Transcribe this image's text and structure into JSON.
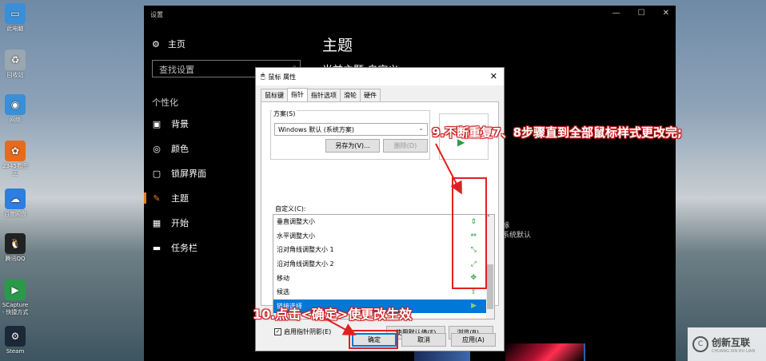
{
  "desktop_icons": [
    {
      "label": "此电脑",
      "color": "#3a8fd6",
      "glyph": "▭",
      "icon": "computer-icon"
    },
    {
      "label": "回收站",
      "color": "#9aa6b0",
      "glyph": "♻",
      "icon": "recycle-bin-icon"
    },
    {
      "label": "网络",
      "color": "#3a8fd6",
      "glyph": "◉",
      "icon": "network-icon"
    },
    {
      "label": "2345看图王",
      "color": "#e86a1a",
      "glyph": "✿",
      "icon": "app-icon"
    },
    {
      "label": "百度网盘",
      "color": "#2f7de1",
      "glyph": "☁",
      "icon": "cloud-icon"
    },
    {
      "label": "腾讯QQ",
      "color": "#222",
      "glyph": "🐧",
      "icon": "qq-icon"
    },
    {
      "label": "SCapture - 快捷方式",
      "color": "#2a9a4a",
      "glyph": "▶",
      "icon": "capture-icon"
    },
    {
      "label": "Steam",
      "color": "#1b2838",
      "glyph": "⚙",
      "icon": "steam-icon"
    }
  ],
  "settings": {
    "title": "设置",
    "home": "主页",
    "search_placeholder": "查找设置",
    "section": "个性化",
    "nav": [
      {
        "label": "背景",
        "glyph": "▣",
        "icon": "background-icon",
        "active": false
      },
      {
        "label": "颜色",
        "glyph": "◎",
        "icon": "palette-icon",
        "active": false
      },
      {
        "label": "锁屏界面",
        "glyph": "▢",
        "icon": "lock-screen-icon",
        "active": false
      },
      {
        "label": "主题",
        "glyph": "✎",
        "icon": "theme-icon",
        "active": true
      },
      {
        "label": "开始",
        "glyph": "▦",
        "icon": "start-icon",
        "active": false
      },
      {
        "label": "任务栏",
        "glyph": "▬",
        "icon": "taskbar-icon",
        "active": false
      }
    ],
    "main_title": "主题",
    "main_sub": "当前主题:自定义",
    "theme_text1": "标",
    "theme_text2": "系统默认"
  },
  "dialog": {
    "title": "鼠标 属性",
    "close": "✕",
    "tabs": [
      "鼠标键",
      "指针",
      "指针选项",
      "滑轮",
      "硬件"
    ],
    "active_tab": 1,
    "scheme_label": "方案(S)",
    "scheme_value": "Windows 默认 (系统方案)",
    "save_as": "另存为(V)...",
    "delete": "删除(D)",
    "custom_label": "自定义(C):",
    "cursor_rows": [
      {
        "label": "垂直调整大小",
        "glyph": "⇕"
      },
      {
        "label": "水平调整大小",
        "glyph": "⇔"
      },
      {
        "label": "沿对角线调整大小 1",
        "glyph": "⤡"
      },
      {
        "label": "沿对角线调整大小 2",
        "glyph": "⤢"
      },
      {
        "label": "移动",
        "glyph": "✥"
      },
      {
        "label": "候选",
        "glyph": "⇧"
      },
      {
        "label": "链接选择",
        "glyph": "▶"
      }
    ],
    "selected_row": 6,
    "shadow_label": "启用指针阴影(E)",
    "use_default": "使用默认值(F)",
    "browse": "浏览(B)...",
    "ok": "确定",
    "cancel": "取消",
    "apply": "应用(A)"
  },
  "annotations": {
    "step9": "9.不断重复7、8步骤直到全部鼠标样式更改完;",
    "step10": "10.点击<确定>使更改生效"
  },
  "watermark": {
    "text": "创新互联",
    "sub": "CHUANG XIN HU LIAN"
  },
  "colors": {
    "accent": "#e47d1e",
    "selection": "#0078d7",
    "annotation": "#e02020"
  }
}
